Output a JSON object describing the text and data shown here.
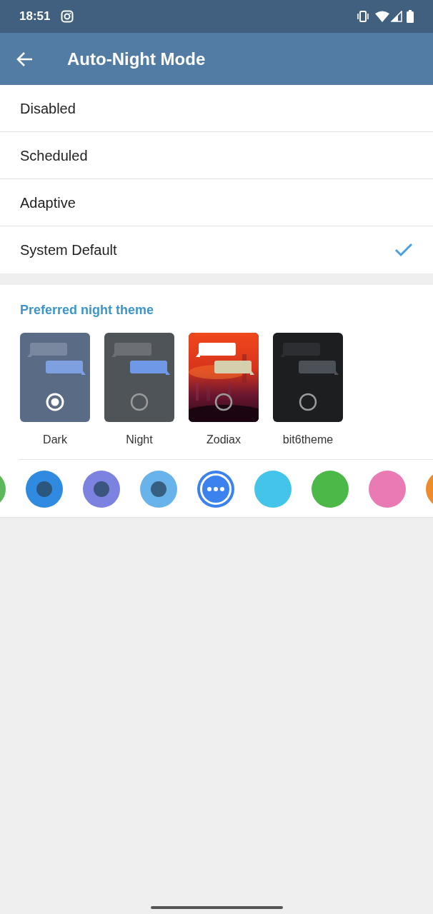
{
  "status_bar": {
    "time": "18:51"
  },
  "app_bar": {
    "title": "Auto-Night Mode"
  },
  "modes": [
    {
      "label": "Disabled",
      "selected": false
    },
    {
      "label": "Scheduled",
      "selected": false
    },
    {
      "label": "Adaptive",
      "selected": false
    },
    {
      "label": "System Default",
      "selected": true
    }
  ],
  "night_theme": {
    "heading": "Preferred night theme",
    "themes": [
      {
        "label": "Dark",
        "kind": "dark",
        "selected": true
      },
      {
        "label": "Night",
        "kind": "night",
        "selected": false
      },
      {
        "label": "Zodiax",
        "kind": "picture",
        "selected": false
      },
      {
        "label": "bit6theme",
        "kind": "black",
        "selected": false
      }
    ],
    "accents": [
      {
        "kind": "plain",
        "color": "#5cb85a",
        "selected": false
      },
      {
        "kind": "dot",
        "color": "#2f8ae0",
        "selected": false
      },
      {
        "kind": "dot",
        "color": "#7b82e0",
        "selected": false
      },
      {
        "kind": "dot",
        "color": "#68b4ea",
        "selected": false
      },
      {
        "kind": "more",
        "color": "#3b82ee",
        "selected": true
      },
      {
        "kind": "plain",
        "color": "#45c4ea",
        "selected": false
      },
      {
        "kind": "plain",
        "color": "#4bb848",
        "selected": false
      },
      {
        "kind": "plain",
        "color": "#ea7ab4",
        "selected": false
      },
      {
        "kind": "plain",
        "color": "#ee8c2c",
        "selected": false
      }
    ]
  }
}
